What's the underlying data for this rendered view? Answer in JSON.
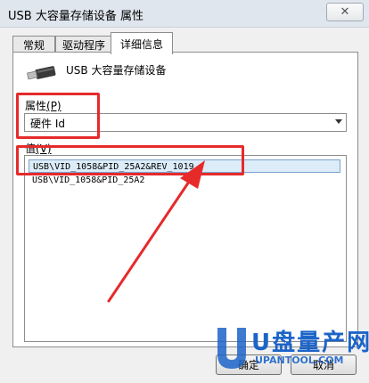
{
  "window": {
    "title": "USB 大容量存储设备 属性",
    "close_glyph": "✕"
  },
  "tabs": [
    {
      "label": "常规",
      "active": false
    },
    {
      "label": "驱动程序",
      "active": false
    },
    {
      "label": "详细信息",
      "active": true
    }
  ],
  "device": {
    "name": "USB 大容量存储设备",
    "icon": "usb-drive-icon"
  },
  "property": {
    "label": "属性",
    "hotkey": "(P)",
    "selected": "硬件 Id"
  },
  "value": {
    "label": "值",
    "hotkey": "(V)",
    "items": [
      {
        "text": "USB\\VID_1058&PID_25A2&REV_1019",
        "selected": true
      },
      {
        "text": "USB\\VID_1058&PID_25A2",
        "selected": false
      }
    ]
  },
  "buttons": {
    "ok": "确定",
    "cancel": "取消"
  },
  "watermark": {
    "brand": "U盘量产网",
    "url": "UPANTOOL.COM"
  },
  "colors": {
    "annotation": "#e62a2a",
    "selection": "#dcecf8",
    "watermark": "#1c64c8"
  }
}
